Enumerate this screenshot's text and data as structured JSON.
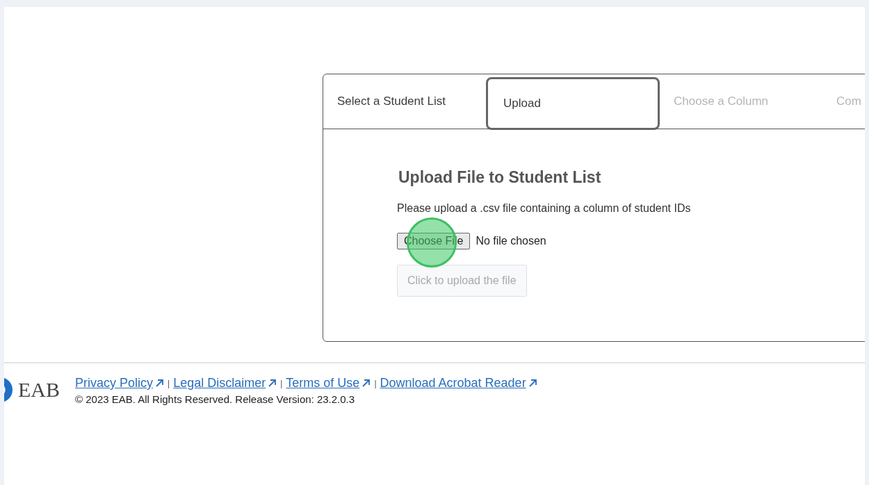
{
  "tabs": [
    {
      "label": "Select a Student List",
      "selected": false,
      "disabled": false
    },
    {
      "label": "Upload",
      "selected": true,
      "disabled": false
    },
    {
      "label": "Choose a Column",
      "selected": false,
      "disabled": true
    },
    {
      "label": "Com",
      "selected": false,
      "disabled": true
    }
  ],
  "upload": {
    "title": "Upload File to Student List",
    "instructions": "Please upload a .csv file containing a column of student IDs",
    "file_button": "Choose File",
    "file_status": "No file chosen",
    "submit": {
      "label": "Click to upload the file",
      "disabled": true
    }
  },
  "footer": {
    "logo_text": "EAB",
    "links": [
      "Privacy Policy",
      "Legal Disclaimer",
      "Terms of Use",
      "Download Acrobat Reader"
    ],
    "separators": [
      "|",
      "|",
      "|"
    ],
    "copyright": "© 2023 EAB. All Rights Reserved. Release Version: 23.2.0.3"
  }
}
